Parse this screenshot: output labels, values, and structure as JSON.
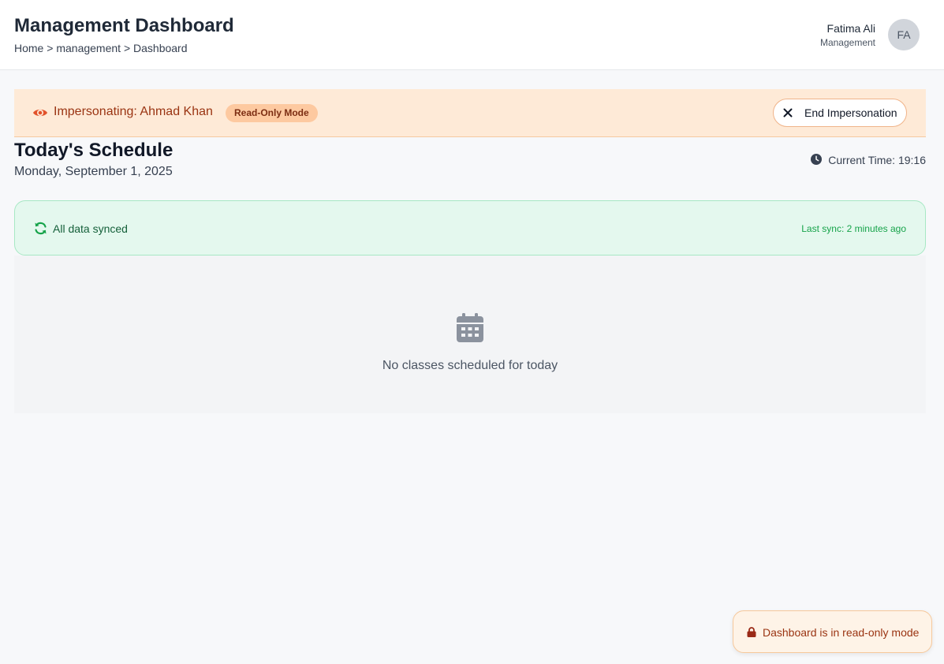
{
  "header": {
    "title": "Management Dashboard",
    "breadcrumb": [
      "Home",
      "management",
      "Dashboard"
    ],
    "breadcrumb_separator": ">"
  },
  "user": {
    "name": "Fatima Ali",
    "role": "Management",
    "initials": "FA"
  },
  "impersonation": {
    "text": "Impersonating: Ahmad Khan",
    "badge": "Read-Only Mode",
    "end_button_label": "End Impersonation",
    "icon": "eye-icon"
  },
  "schedule": {
    "title": "Today's Schedule",
    "date": "Monday, September 1, 2025",
    "current_time": "Current Time: 19:16"
  },
  "sync": {
    "status": "All data synced",
    "last_sync": "Last sync: 2 minutes ago",
    "icon": "sync-icon"
  },
  "empty_state": {
    "message": "No classes scheduled for today",
    "icon": "calendar-icon"
  },
  "toast": {
    "message": "Dashboard is in read-only mode",
    "icon": "lock-icon"
  },
  "colors": {
    "impersonation_bg": "#feead7",
    "impersonation_text": "#9a3412",
    "sync_bg": "#e4f8ee",
    "sync_accent": "#16a34a",
    "page_bg": "#f7f8fa"
  }
}
